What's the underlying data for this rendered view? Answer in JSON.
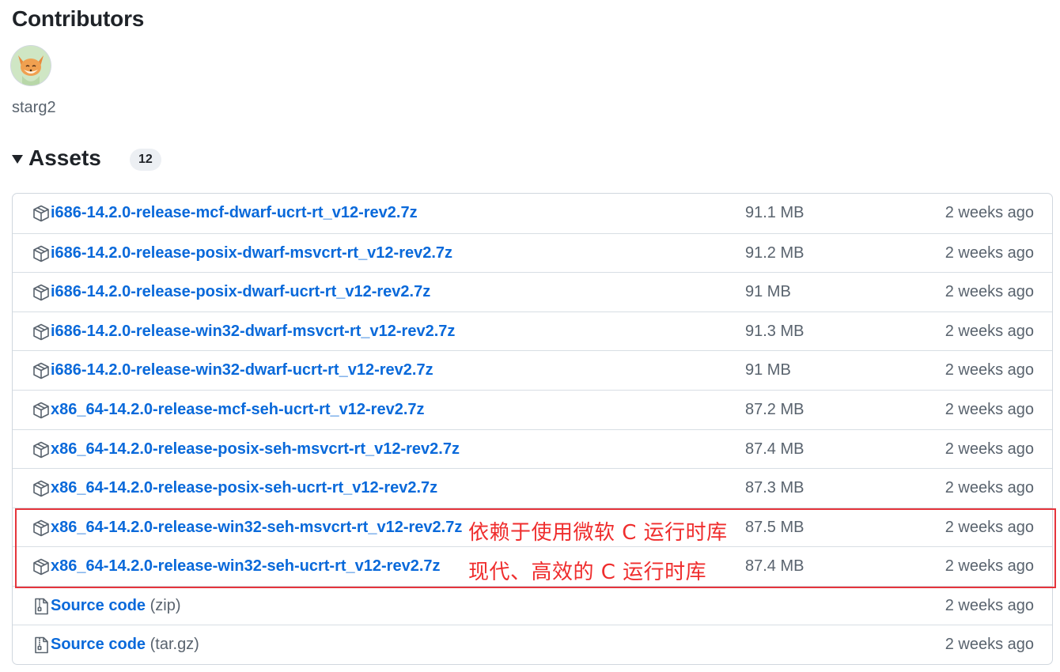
{
  "contributors": {
    "title": "Contributors",
    "users": [
      {
        "name": "starg2"
      }
    ]
  },
  "assets": {
    "title": "Assets",
    "count": "12",
    "items": [
      {
        "name": "i686-14.2.0-release-mcf-dwarf-ucrt-rt_v12-rev2.7z",
        "size": "91.1 MB",
        "date": "2 weeks ago",
        "icon": "package-icon"
      },
      {
        "name": "i686-14.2.0-release-posix-dwarf-msvcrt-rt_v12-rev2.7z",
        "size": "91.2 MB",
        "date": "2 weeks ago",
        "icon": "package-icon"
      },
      {
        "name": "i686-14.2.0-release-posix-dwarf-ucrt-rt_v12-rev2.7z",
        "size": "91 MB",
        "date": "2 weeks ago",
        "icon": "package-icon"
      },
      {
        "name": "i686-14.2.0-release-win32-dwarf-msvcrt-rt_v12-rev2.7z",
        "size": "91.3 MB",
        "date": "2 weeks ago",
        "icon": "package-icon"
      },
      {
        "name": "i686-14.2.0-release-win32-dwarf-ucrt-rt_v12-rev2.7z",
        "size": "91 MB",
        "date": "2 weeks ago",
        "icon": "package-icon"
      },
      {
        "name": "x86_64-14.2.0-release-mcf-seh-ucrt-rt_v12-rev2.7z",
        "size": "87.2 MB",
        "date": "2 weeks ago",
        "icon": "package-icon"
      },
      {
        "name": "x86_64-14.2.0-release-posix-seh-msvcrt-rt_v12-rev2.7z",
        "size": "87.4 MB",
        "date": "2 weeks ago",
        "icon": "package-icon"
      },
      {
        "name": "x86_64-14.2.0-release-posix-seh-ucrt-rt_v12-rev2.7z",
        "size": "87.3 MB",
        "date": "2 weeks ago",
        "icon": "package-icon"
      },
      {
        "name": "x86_64-14.2.0-release-win32-seh-msvcrt-rt_v12-rev2.7z",
        "size": "87.5 MB",
        "date": "2 weeks ago",
        "icon": "package-icon"
      },
      {
        "name": "x86_64-14.2.0-release-win32-seh-ucrt-rt_v12-rev2.7z",
        "size": "87.4 MB",
        "date": "2 weeks ago",
        "icon": "package-icon"
      },
      {
        "name": "Source code",
        "suffix": "(zip)",
        "size": "",
        "date": "2 weeks ago",
        "icon": "file-zip-icon"
      },
      {
        "name": "Source code",
        "suffix": "(tar.gz)",
        "size": "",
        "date": "2 weeks ago",
        "icon": "file-zip-icon"
      }
    ]
  },
  "annotations": [
    "依赖于使用微软 C 运行时库",
    "现代、高效的 C 运行时库"
  ],
  "colors": {
    "link": "#0969da",
    "muted": "#59636e",
    "annotation": "#ef2d2d"
  }
}
